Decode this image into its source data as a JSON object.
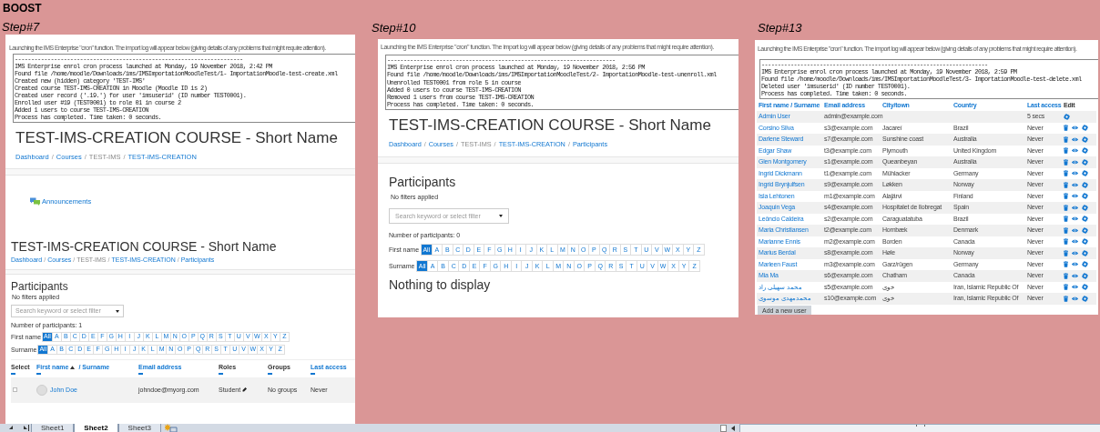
{
  "sheet": {
    "title": "BOOST"
  },
  "steps": [
    {
      "label": "Step#7",
      "pages": [
        {
          "blocks": [
            {
              "kind": "intro",
              "text": "Launching the IMS Enterprise \"cron\" function. The import log will appear below (giving details of any problems that might require attention)."
            },
            {
              "kind": "log",
              "lines": [
                "----------------------------------------------------------------------",
                "IMS Enterprise enrol cron process launched at Monday, 19 November 2018, 2:42 PM",
                "Found file /home/moodle/Downloads/ims/IMSImportationMoodleTest/1- ImportationMoodle-test-create.xml",
                "Created new (hidden) category 'TEST-IMS'",
                "Created course TEST-IMS-CREATION in Moodle (Moodle ID is 2)",
                "Created user record ('.19.') for user 'imsuserid' (ID number TEST0001).",
                "Enrolled user #19 (TEST0001) to role 01 in course 2",
                "Added 1 users to course TEST-IMS-CREATION",
                "Process has completed. Time taken: 0 seconds."
              ]
            },
            {
              "kind": "heading",
              "text": "TEST-IMS-CREATION COURSE - Short Name"
            },
            {
              "kind": "breadcrumb",
              "separator": "/",
              "items": [
                {
                  "text": "Dashboard",
                  "link": true
                },
                {
                  "text": "Courses",
                  "link": true
                },
                {
                  "text": "TEST-IMS",
                  "link": false
                },
                {
                  "text": "TEST-IMS-CREATION",
                  "link": true
                }
              ]
            },
            {
              "kind": "activity",
              "text": "Announcements"
            }
          ]
        },
        {
          "blocks": [
            {
              "kind": "heading",
              "text": "TEST-IMS-CREATION COURSE - Short Name"
            },
            {
              "kind": "breadcrumb",
              "separator": "/",
              "items": [
                {
                  "text": "Dashboard",
                  "link": true
                },
                {
                  "text": "Courses",
                  "link": true
                },
                {
                  "text": "TEST-IMS",
                  "link": false
                },
                {
                  "text": "TEST-IMS-CREATION",
                  "link": true
                },
                {
                  "text": "Participants",
                  "link": true
                }
              ]
            },
            {
              "kind": "section",
              "text": "Participants"
            },
            {
              "kind": "note",
              "text": "No filters applied"
            },
            {
              "kind": "search",
              "placeholder": "Search keyword or select filter"
            },
            {
              "kind": "text",
              "text": "Number of participants: 1"
            },
            {
              "kind": "initials",
              "label": "First name",
              "letters": [
                {
                  "label": "All",
                  "selected": true
                },
                {
                  "label": "A",
                  "selected": false
                },
                {
                  "label": "B",
                  "selected": false
                },
                {
                  "label": "C",
                  "selected": false
                },
                {
                  "label": "D",
                  "selected": false
                },
                {
                  "label": "E",
                  "selected": false
                },
                {
                  "label": "F",
                  "selected": false
                },
                {
                  "label": "G",
                  "selected": false
                },
                {
                  "label": "H",
                  "selected": false
                },
                {
                  "label": "I",
                  "selected": false
                },
                {
                  "label": "J",
                  "selected": false
                },
                {
                  "label": "K",
                  "selected": false
                },
                {
                  "label": "L",
                  "selected": false
                },
                {
                  "label": "M",
                  "selected": false
                },
                {
                  "label": "N",
                  "selected": false
                },
                {
                  "label": "O",
                  "selected": false
                },
                {
                  "label": "P",
                  "selected": false
                },
                {
                  "label": "Q",
                  "selected": false
                },
                {
                  "label": "R",
                  "selected": false
                },
                {
                  "label": "S",
                  "selected": false
                },
                {
                  "label": "T",
                  "selected": false
                },
                {
                  "label": "U",
                  "selected": false
                },
                {
                  "label": "V",
                  "selected": false
                },
                {
                  "label": "W",
                  "selected": false
                },
                {
                  "label": "X",
                  "selected": false
                },
                {
                  "label": "Y",
                  "selected": false
                },
                {
                  "label": "Z",
                  "selected": false
                }
              ]
            },
            {
              "kind": "initials",
              "label": "Surname",
              "letters": [
                {
                  "label": "All",
                  "selected": true
                },
                {
                  "label": "A",
                  "selected": false
                },
                {
                  "label": "B",
                  "selected": false
                },
                {
                  "label": "C",
                  "selected": false
                },
                {
                  "label": "D",
                  "selected": false
                },
                {
                  "label": "E",
                  "selected": false
                },
                {
                  "label": "F",
                  "selected": false
                },
                {
                  "label": "G",
                  "selected": false
                },
                {
                  "label": "H",
                  "selected": false
                },
                {
                  "label": "I",
                  "selected": false
                },
                {
                  "label": "J",
                  "selected": false
                },
                {
                  "label": "K",
                  "selected": false
                },
                {
                  "label": "L",
                  "selected": false
                },
                {
                  "label": "M",
                  "selected": false
                },
                {
                  "label": "N",
                  "selected": false
                },
                {
                  "label": "O",
                  "selected": false
                },
                {
                  "label": "P",
                  "selected": false
                },
                {
                  "label": "Q",
                  "selected": false
                },
                {
                  "label": "R",
                  "selected": false
                },
                {
                  "label": "S",
                  "selected": false
                },
                {
                  "label": "T",
                  "selected": false
                },
                {
                  "label": "U",
                  "selected": false
                },
                {
                  "label": "V",
                  "selected": false
                },
                {
                  "label": "W",
                  "selected": false
                },
                {
                  "label": "X",
                  "selected": false
                },
                {
                  "label": "Y",
                  "selected": false
                },
                {
                  "label": "Z",
                  "selected": false
                }
              ]
            },
            {
              "kind": "participants_table",
              "columns": [
                {
                  "label": "Select",
                  "link": false
                },
                {
                  "label": "First name",
                  "link": true,
                  "sorted": true,
                  "label2": "/ Surname"
                },
                {
                  "label": "Email address",
                  "link": true
                },
                {
                  "label": "Roles",
                  "link": false
                },
                {
                  "label": "Groups",
                  "link": false
                },
                {
                  "label": "Last access",
                  "link": true
                }
              ],
              "rows": [
                {
                  "checked": false,
                  "name": "John Doe",
                  "email": "johndoe@myorg.com",
                  "role": "Student",
                  "groups": "No groups",
                  "last_access": "Never"
                }
              ]
            }
          ]
        }
      ]
    },
    {
      "label": "Step#10",
      "pages": [
        {
          "blocks": [
            {
              "kind": "intro",
              "text": "Launching the IMS Enterprise \"cron\" function. The import log will appear below (giving details of any problems that might require attention)."
            },
            {
              "kind": "log",
              "lines": [
                "----------------------------------------------------------------------",
                "IMS Enterprise enrol cron process launched at Monday, 19 November 2018, 2:56 PM",
                "Found file /home/moodle/Downloads/ims/IMSImportationMoodleTest/2- ImportationMoodle-test-unenroll.xml",
                "Unenrolled TEST0001 from role 5 in course",
                "Added 0 users to course TEST-IMS-CREATION",
                "Removed 1 users from course TEST-IMS-CREATION",
                "Process has completed. Time taken: 0 seconds."
              ]
            },
            {
              "kind": "heading",
              "text": "TEST-IMS-CREATION COURSE - Short Name"
            },
            {
              "kind": "breadcrumb",
              "separator": "/",
              "items": [
                {
                  "text": "Dashboard",
                  "link": true
                },
                {
                  "text": "Courses",
                  "link": true
                },
                {
                  "text": "TEST-IMS",
                  "link": false
                },
                {
                  "text": "TEST-IMS-CREATION",
                  "link": true
                },
                {
                  "text": "Participants",
                  "link": true
                }
              ]
            },
            {
              "kind": "section",
              "text": "Participants"
            },
            {
              "kind": "note",
              "text": "No filters applied"
            },
            {
              "kind": "search",
              "placeholder": "Search keyword or select filter"
            },
            {
              "kind": "text",
              "text": "Number of participants: 0"
            },
            {
              "kind": "initials",
              "label": "First name",
              "letters": [
                {
                  "label": "All",
                  "selected": true
                },
                {
                  "label": "A",
                  "selected": false
                },
                {
                  "label": "B",
                  "selected": false
                },
                {
                  "label": "C",
                  "selected": false
                },
                {
                  "label": "D",
                  "selected": false
                },
                {
                  "label": "E",
                  "selected": false
                },
                {
                  "label": "F",
                  "selected": false
                },
                {
                  "label": "G",
                  "selected": false
                },
                {
                  "label": "H",
                  "selected": false
                },
                {
                  "label": "I",
                  "selected": false
                },
                {
                  "label": "J",
                  "selected": false
                },
                {
                  "label": "K",
                  "selected": false
                },
                {
                  "label": "L",
                  "selected": false
                },
                {
                  "label": "M",
                  "selected": false
                },
                {
                  "label": "N",
                  "selected": false
                },
                {
                  "label": "O",
                  "selected": false
                },
                {
                  "label": "P",
                  "selected": false
                },
                {
                  "label": "Q",
                  "selected": false
                },
                {
                  "label": "R",
                  "selected": false
                },
                {
                  "label": "S",
                  "selected": false
                },
                {
                  "label": "T",
                  "selected": false
                },
                {
                  "label": "U",
                  "selected": false
                },
                {
                  "label": "V",
                  "selected": false
                },
                {
                  "label": "W",
                  "selected": false
                },
                {
                  "label": "X",
                  "selected": false
                },
                {
                  "label": "Y",
                  "selected": false
                },
                {
                  "label": "Z",
                  "selected": false
                }
              ]
            },
            {
              "kind": "initials",
              "label": "Surname",
              "letters": [
                {
                  "label": "All",
                  "selected": true
                },
                {
                  "label": "A",
                  "selected": false
                },
                {
                  "label": "B",
                  "selected": false
                },
                {
                  "label": "C",
                  "selected": false
                },
                {
                  "label": "D",
                  "selected": false
                },
                {
                  "label": "E",
                  "selected": false
                },
                {
                  "label": "F",
                  "selected": false
                },
                {
                  "label": "G",
                  "selected": false
                },
                {
                  "label": "H",
                  "selected": false
                },
                {
                  "label": "I",
                  "selected": false
                },
                {
                  "label": "J",
                  "selected": false
                },
                {
                  "label": "K",
                  "selected": false
                },
                {
                  "label": "L",
                  "selected": false
                },
                {
                  "label": "M",
                  "selected": false
                },
                {
                  "label": "N",
                  "selected": false
                },
                {
                  "label": "O",
                  "selected": false
                },
                {
                  "label": "P",
                  "selected": false
                },
                {
                  "label": "Q",
                  "selected": false
                },
                {
                  "label": "R",
                  "selected": false
                },
                {
                  "label": "S",
                  "selected": false
                },
                {
                  "label": "T",
                  "selected": false
                },
                {
                  "label": "U",
                  "selected": false
                },
                {
                  "label": "V",
                  "selected": false
                },
                {
                  "label": "W",
                  "selected": false
                },
                {
                  "label": "X",
                  "selected": false
                },
                {
                  "label": "Y",
                  "selected": false
                },
                {
                  "label": "Z",
                  "selected": false
                }
              ]
            },
            {
              "kind": "empty",
              "text": "Nothing to display"
            }
          ]
        }
      ]
    },
    {
      "label": "Step#13",
      "pages": [
        {
          "blocks": [
            {
              "kind": "intro",
              "text": "Launching the IMS Enterprise \"cron\" function. The import log will appear below (giving details of any problems that might require attention)."
            },
            {
              "kind": "log",
              "lines": [
                "----------------------------------------------------------------------",
                "IMS Enterprise enrol cron process launched at Monday, 19 November 2018, 2:59 PM",
                "Found file /home/moodle/Downloads/ims/IMSImportationMoodleTest/3- ImportationMoodle-test-delete.xml",
                "Deleted user 'imsuserid' (ID number TEST0001).",
                "Process has completed. Time taken: 0 seconds."
              ]
            },
            {
              "kind": "users_table",
              "columns": [
                {
                  "label": "First name / Surname",
                  "link": true
                },
                {
                  "label": "Email address",
                  "link": true
                },
                {
                  "label": "City/town",
                  "link": true
                },
                {
                  "label": "Country",
                  "link": true
                },
                {
                  "label": "Last access",
                  "link": true
                },
                {
                  "label": "Edit",
                  "link": false
                }
              ],
              "rows": [
                {
                  "kind": "admin",
                  "name": "Admin User",
                  "email": "admin@example.com",
                  "last_access": "5 secs"
                },
                {
                  "kind": "user",
                  "name": "Corsino Silva",
                  "email": "s3@example.com",
                  "city": "Jacareí",
                  "country": "Brazil",
                  "last_access": "Never"
                },
                {
                  "kind": "user",
                  "name": "Darlene Steward",
                  "email": "s7@example.com",
                  "city": "Sunshine coast",
                  "country": "Australia",
                  "last_access": "Never"
                },
                {
                  "kind": "user",
                  "name": "Edgar Shaw",
                  "email": "t3@example.com",
                  "city": "Plymouth",
                  "country": "United Kingdom",
                  "last_access": "Never"
                },
                {
                  "kind": "user",
                  "name": "Glen Montgomery",
                  "email": "s1@example.com",
                  "city": "Queanbeyan",
                  "country": "Australia",
                  "last_access": "Never"
                },
                {
                  "kind": "user",
                  "name": "Ingrid Dickmann",
                  "email": "t1@example.com",
                  "city": "Mühlacker",
                  "country": "Germany",
                  "last_access": "Never"
                },
                {
                  "kind": "user",
                  "name": "Ingrid Brynjulfsen",
                  "email": "s9@example.com",
                  "city": "Løkken",
                  "country": "Norway",
                  "last_access": "Never"
                },
                {
                  "kind": "user",
                  "name": "Isla Lehtonen",
                  "email": "m1@example.com",
                  "city": "Alajärvi",
                  "country": "Finland",
                  "last_access": "Never"
                },
                {
                  "kind": "user",
                  "name": "Joaquin Vega",
                  "email": "s4@example.com",
                  "city": "Hospitalet de llobregat",
                  "country": "Spain",
                  "last_access": "Never"
                },
                {
                  "kind": "user",
                  "name": "Leôncio Caldeira",
                  "email": "s2@example.com",
                  "city": "Caraguatatuba",
                  "country": "Brazil",
                  "last_access": "Never"
                },
                {
                  "kind": "user",
                  "name": "Maria Christiansen",
                  "email": "t2@example.com",
                  "city": "Hornbæk",
                  "country": "Denmark",
                  "last_access": "Never"
                },
                {
                  "kind": "user",
                  "name": "Marianne Ennis",
                  "email": "m2@example.com",
                  "city": "Borden",
                  "country": "Canada",
                  "last_access": "Never"
                },
                {
                  "kind": "user",
                  "name": "Marius Berdal",
                  "email": "s8@example.com",
                  "city": "Høle",
                  "country": "Norway",
                  "last_access": "Never"
                },
                {
                  "kind": "user",
                  "name": "Marleen Faust",
                  "email": "m3@example.com",
                  "city": "Garz/rügen",
                  "country": "Germany",
                  "last_access": "Never"
                },
                {
                  "kind": "user",
                  "name": "Mia Ma",
                  "email": "s6@example.com",
                  "city": "Chatham",
                  "country": "Canada",
                  "last_access": "Never"
                },
                {
                  "kind": "user",
                  "name": "محمد سهیلی راد",
                  "email": "s5@example.com",
                  "city": "خوی",
                  "country": "Iran, Islamic Republic Of",
                  "last_access": "Never"
                },
                {
                  "kind": "user",
                  "name": "محمدمهدی موسوی",
                  "email": "s10@example.com",
                  "city": "خوی",
                  "country": "Iran, Islamic Republic Of",
                  "last_access": "Never"
                }
              ]
            },
            {
              "kind": "button",
              "text": "Add a new user"
            }
          ]
        }
      ]
    }
  ],
  "sheet_tabs": [
    {
      "label": "Sheet1",
      "selected": false
    },
    {
      "label": "Sheet2",
      "selected": true
    },
    {
      "label": "Sheet3",
      "selected": false
    }
  ]
}
